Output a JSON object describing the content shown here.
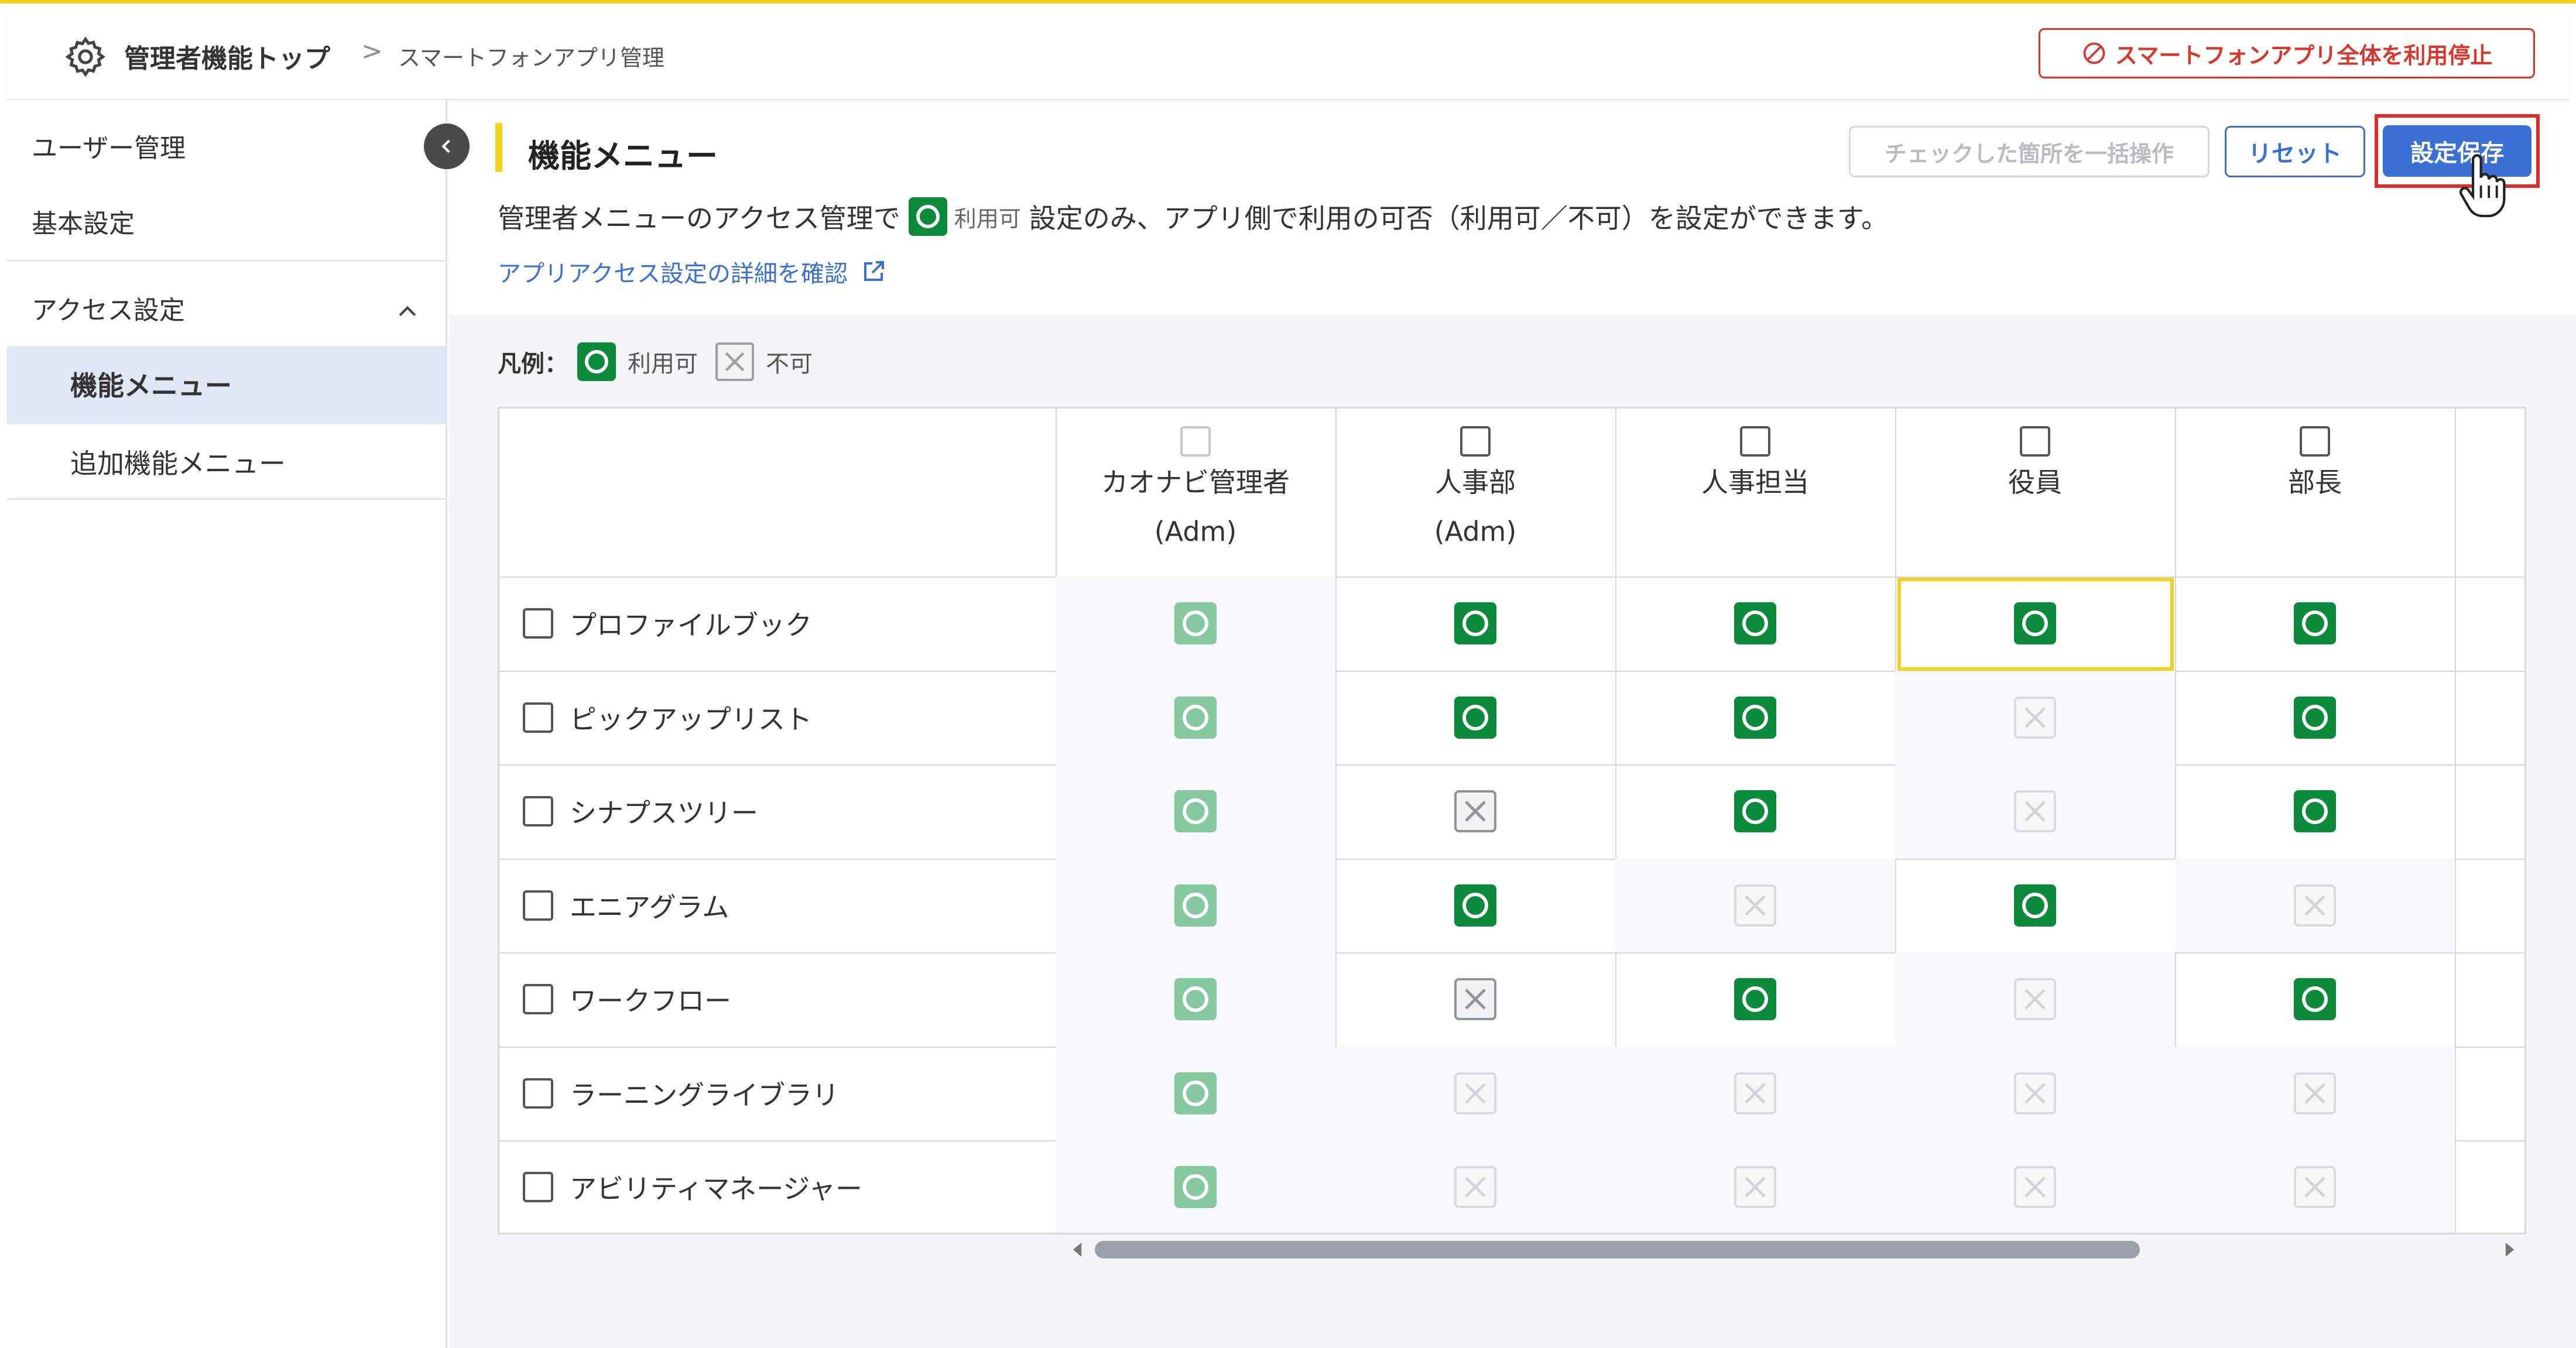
{
  "header": {
    "breadcrumb_home": "管理者機能トップ",
    "breadcrumb_sep": ">",
    "breadcrumb_current": "スマートフォンアプリ管理",
    "stop_all_label": "スマートフォンアプリ全体を利用停止"
  },
  "sidebar": {
    "user_admin": "ユーザー管理",
    "basic_settings": "基本設定",
    "access_settings": "アクセス設定",
    "feature_menu": "機能メニュー",
    "additional_feature_menu": "追加機能メニュー"
  },
  "main": {
    "title": "機能メニュー",
    "bulk_action_label": "チェックした箇所を一括操作",
    "reset_label": "リセット",
    "save_label": "設定保存",
    "desc_part1": "管理者メニューのアクセス管理で",
    "desc_mini": "利用可",
    "desc_part2": "設定のみ、アプリ側で利用の可否（利用可／不可）を設定ができます。",
    "detail_link": "アプリアクセス設定の詳細を確認",
    "legend_title": "凡例：",
    "legend_ok": "利用可",
    "legend_ng": "不可"
  },
  "table": {
    "columns": [
      {
        "line1": "カオナビ管理者",
        "line2": "(Adm)",
        "checkbox_disabled": true
      },
      {
        "line1": "人事部",
        "line2": "(Adm)",
        "checkbox_disabled": false
      },
      {
        "line1": "人事担当",
        "line2": "",
        "checkbox_disabled": false
      },
      {
        "line1": "役員",
        "line2": "",
        "checkbox_disabled": false
      },
      {
        "line1": "部長",
        "line2": "",
        "checkbox_disabled": false
      }
    ],
    "rows": [
      {
        "name": "プロファイルブック",
        "values": [
          "ok-dis",
          "ok",
          "ok",
          "ok",
          "ok"
        ]
      },
      {
        "name": "ピックアップリスト",
        "values": [
          "ok-dis",
          "ok",
          "ok",
          "ng-dis",
          "ok"
        ]
      },
      {
        "name": "シナプスツリー",
        "values": [
          "ok-dis",
          "ng",
          "ok",
          "ng-dis",
          "ok"
        ]
      },
      {
        "name": "エニアグラム",
        "values": [
          "ok-dis",
          "ok",
          "ng-dis",
          "ok",
          "ng-dis"
        ]
      },
      {
        "name": "ワークフロー",
        "values": [
          "ok-dis",
          "ng",
          "ok",
          "ng-dis",
          "ok"
        ]
      },
      {
        "name": "ラーニングライブラリ",
        "values": [
          "ok-dis",
          "ng-dis",
          "ng-dis",
          "ng-dis",
          "ng-dis"
        ]
      },
      {
        "name": "アビリティマネージャー",
        "values": [
          "ok-dis",
          "ng-dis",
          "ng-dis",
          "ng-dis",
          "ng-dis"
        ]
      }
    ],
    "selected_cell": {
      "row": 0,
      "col": 3
    }
  },
  "colors": {
    "accent_yellow": "#f5d21f",
    "primary_blue": "#3a70d4",
    "danger_red": "#d9362b",
    "ok_green": "#0a8a3a"
  }
}
